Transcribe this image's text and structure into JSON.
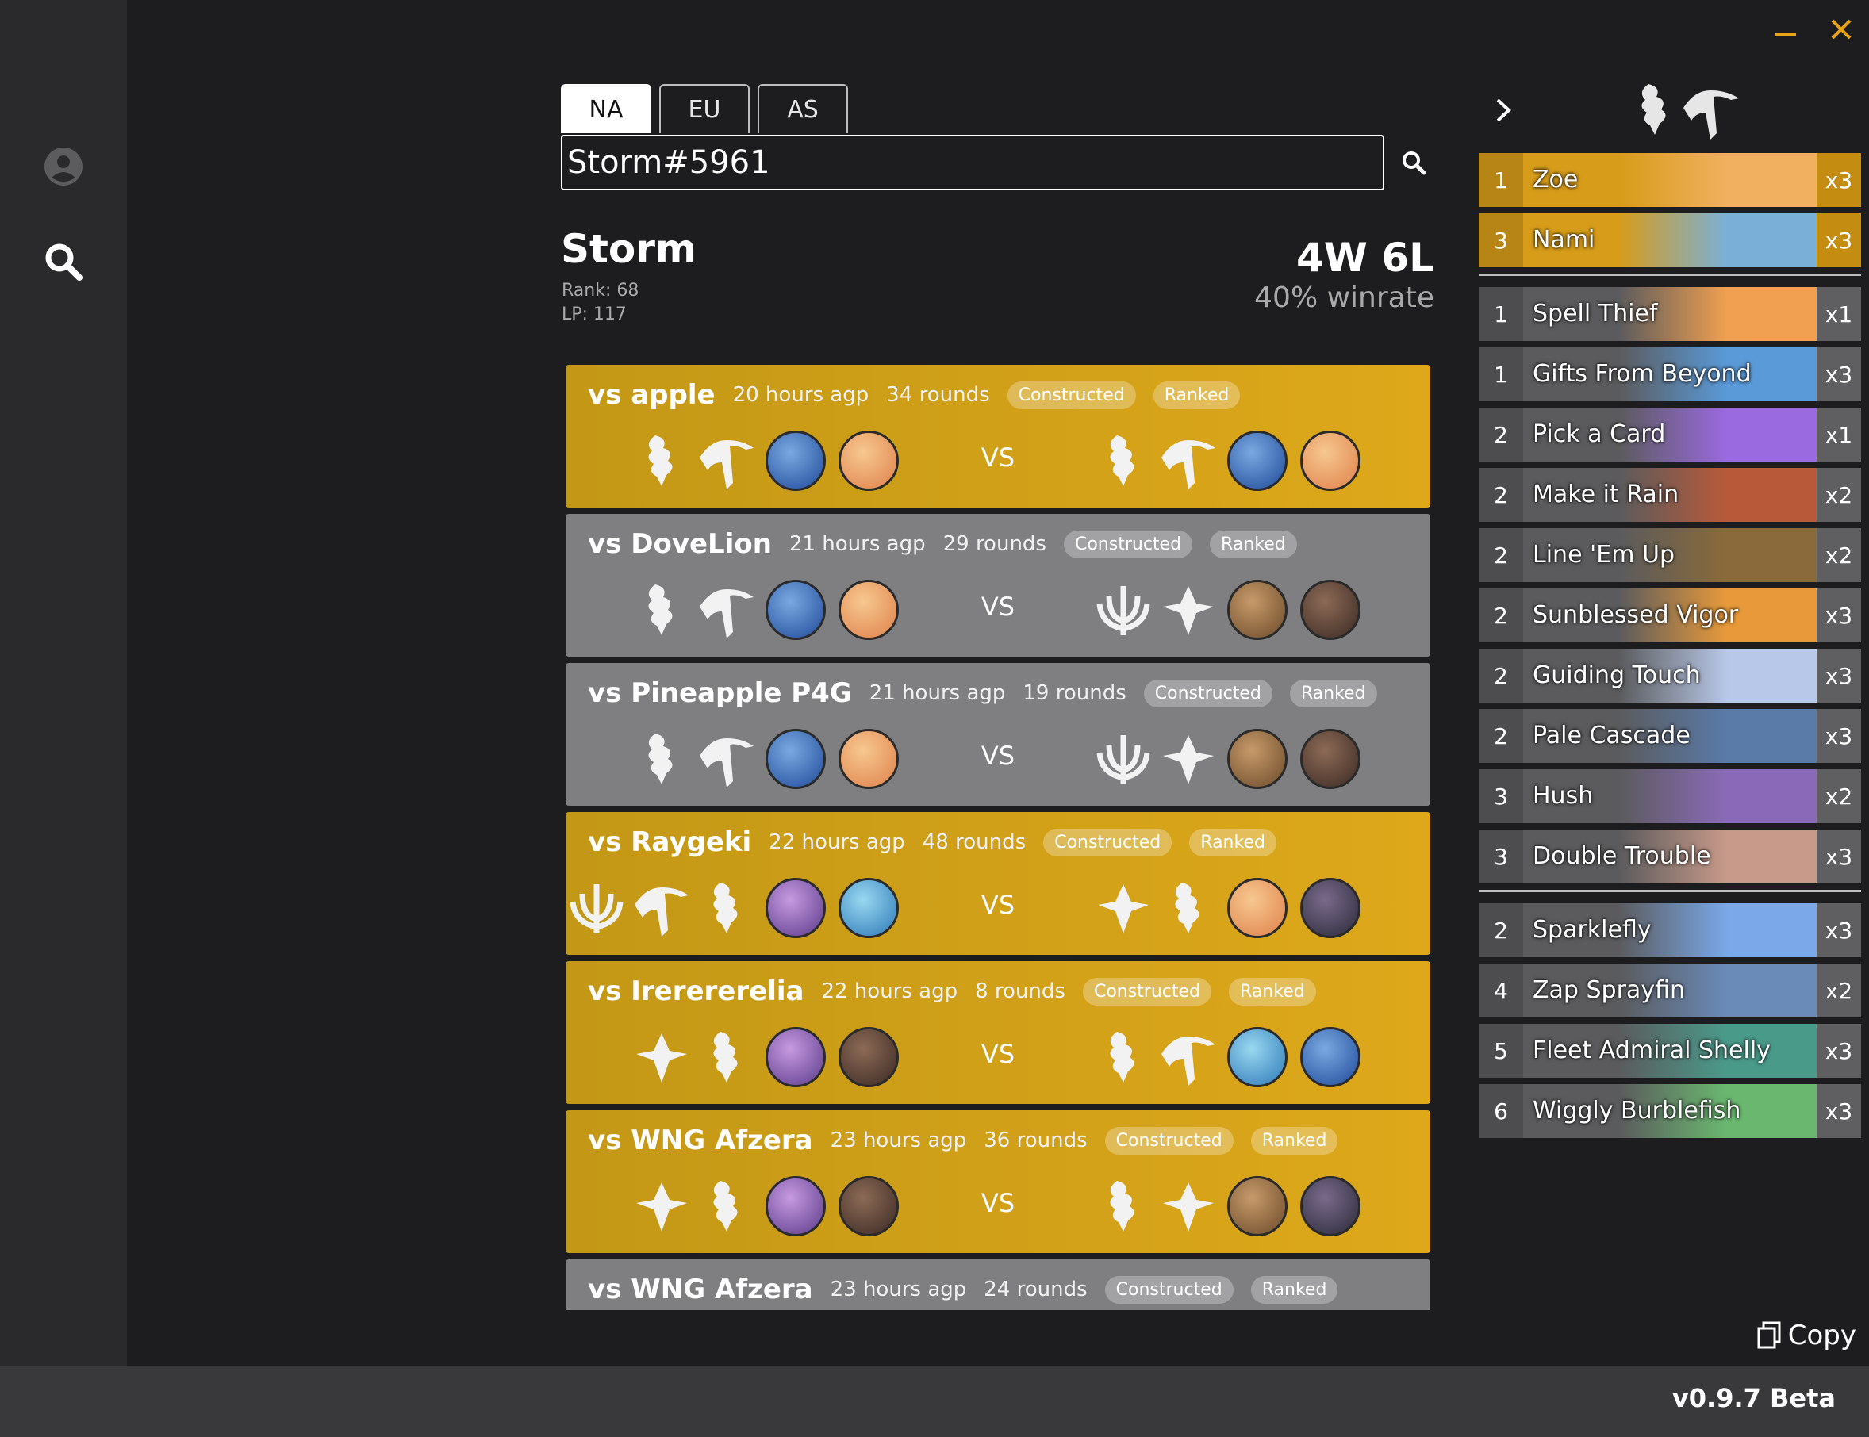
{
  "window": {
    "minimize_icon": "minus-icon",
    "close_icon": "close-icon",
    "accent": "#e8a317"
  },
  "sidebar": {
    "profile_icon": "user-circle-icon",
    "search_icon": "search-icon"
  },
  "regions": [
    "NA",
    "EU",
    "AS"
  ],
  "search": {
    "value": "Storm#5961",
    "icon": "search-icon"
  },
  "player": {
    "name": "Storm",
    "rank": "Rank: 68",
    "lp": "LP: 117",
    "record": "4W 6L",
    "winrate": "40% winrate"
  },
  "colors": {
    "win": "#d8a31a",
    "loss": "#7f7f81"
  },
  "matches": [
    {
      "opponent": "vs apple",
      "time": "20 hours agp",
      "rounds": "34 rounds",
      "mode": "Constructed",
      "type": "Ranked",
      "result": "win",
      "vs": "VS"
    },
    {
      "opponent": "vs DoveLion",
      "time": "21 hours agp",
      "rounds": "29 rounds",
      "mode": "Constructed",
      "type": "Ranked",
      "result": "loss",
      "vs": "VS"
    },
    {
      "opponent": "vs Pineapple P4G",
      "time": "21 hours agp",
      "rounds": "19 rounds",
      "mode": "Constructed",
      "type": "Ranked",
      "result": "loss",
      "vs": "VS"
    },
    {
      "opponent": "vs Raygeki",
      "time": "22 hours agp",
      "rounds": "48 rounds",
      "mode": "Constructed",
      "type": "Ranked",
      "result": "win",
      "vs": "VS"
    },
    {
      "opponent": "vs Irerererelia",
      "time": "22 hours agp",
      "rounds": "8 rounds",
      "mode": "Constructed",
      "type": "Ranked",
      "result": "win",
      "vs": "VS"
    },
    {
      "opponent": "vs WNG Afzera",
      "time": "23 hours agp",
      "rounds": "36 rounds",
      "mode": "Constructed",
      "type": "Ranked",
      "result": "win",
      "vs": "VS"
    },
    {
      "opponent": "vs WNG Afzera",
      "time": "23 hours agp",
      "rounds": "24 rounds",
      "mode": "Constructed",
      "type": "Ranked",
      "result": "loss",
      "vs": "VS"
    }
  ],
  "deck": {
    "champions": [
      {
        "cost": "1",
        "name": "Zoe",
        "count": "x3"
      },
      {
        "cost": "3",
        "name": "Nami",
        "count": "x3"
      }
    ],
    "spells": [
      {
        "cost": "1",
        "name": "Spell Thief",
        "count": "x1"
      },
      {
        "cost": "1",
        "name": "Gifts From Beyond",
        "count": "x3"
      },
      {
        "cost": "2",
        "name": "Pick a Card",
        "count": "x1"
      },
      {
        "cost": "2",
        "name": "Make it Rain",
        "count": "x2"
      },
      {
        "cost": "2",
        "name": "Line 'Em Up",
        "count": "x2"
      },
      {
        "cost": "2",
        "name": "Sunblessed Vigor",
        "count": "x3"
      },
      {
        "cost": "2",
        "name": "Guiding Touch",
        "count": "x3"
      },
      {
        "cost": "2",
        "name": "Pale Cascade",
        "count": "x3"
      },
      {
        "cost": "3",
        "name": "Hush",
        "count": "x2"
      },
      {
        "cost": "3",
        "name": "Double Trouble",
        "count": "x3"
      }
    ],
    "followers": [
      {
        "cost": "2",
        "name": "Sparklefly",
        "count": "x3"
      },
      {
        "cost": "4",
        "name": "Zap Sprayfin",
        "count": "x2"
      },
      {
        "cost": "5",
        "name": "Fleet Admiral Shelly",
        "count": "x3"
      },
      {
        "cost": "6",
        "name": "Wiggly Burblefish",
        "count": "x3"
      }
    ]
  },
  "copy": {
    "label": "Copy",
    "icon": "copy-icon"
  },
  "version": "v0.9.7 Beta"
}
